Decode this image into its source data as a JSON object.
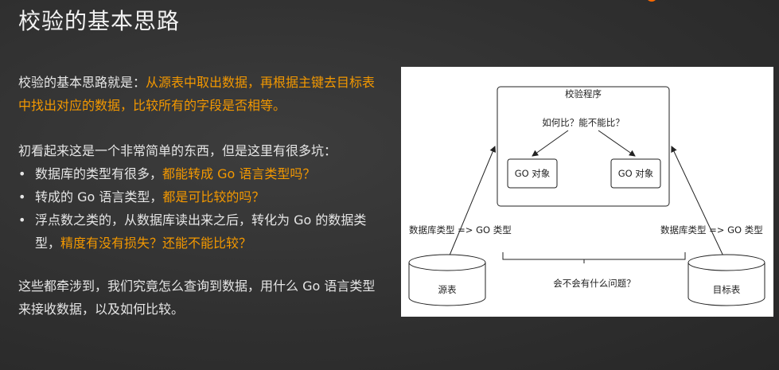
{
  "title": "校验的基本思路",
  "para1": {
    "lead": "校验的基本思路就是：",
    "highlight": "从源表中取出数据，再根据主键去目标表中找出对应的数据，比较所有的字段是否相等。"
  },
  "para2": {
    "intro": "初看起来这是一个非常简单的东西，但是这里有很多坑：",
    "bullets": [
      {
        "text": "数据库的类型有很多，",
        "highlight": "都能转成 Go 语言类型吗？"
      },
      {
        "text": "转成的 Go 语言类型，",
        "highlight": "都是可比较的吗？"
      },
      {
        "text": "浮点数之类的，从数据库读出来之后，转化为 Go 的数据类型，",
        "highlight": "精度有没有损失？还能不能比较？"
      }
    ]
  },
  "para3": "这些都牵涉到，我们究竟怎么查询到数据，用什么 Go 语言类型来接收数据，以及如何比较。",
  "diagram": {
    "program_label": "校验程序",
    "question": "如何比？能不能比？",
    "left_object": "GO 对象",
    "right_object": "GO 对象",
    "left_conversion": "数据库类型 => GO 类型",
    "right_conversion": "数据库类型 => GO 类型",
    "source_table": "源表",
    "target_table": "目标表",
    "issue_question": "会不会有什么问题？"
  },
  "colors": {
    "accent": "#f39800",
    "background": "#2f2f2f"
  }
}
